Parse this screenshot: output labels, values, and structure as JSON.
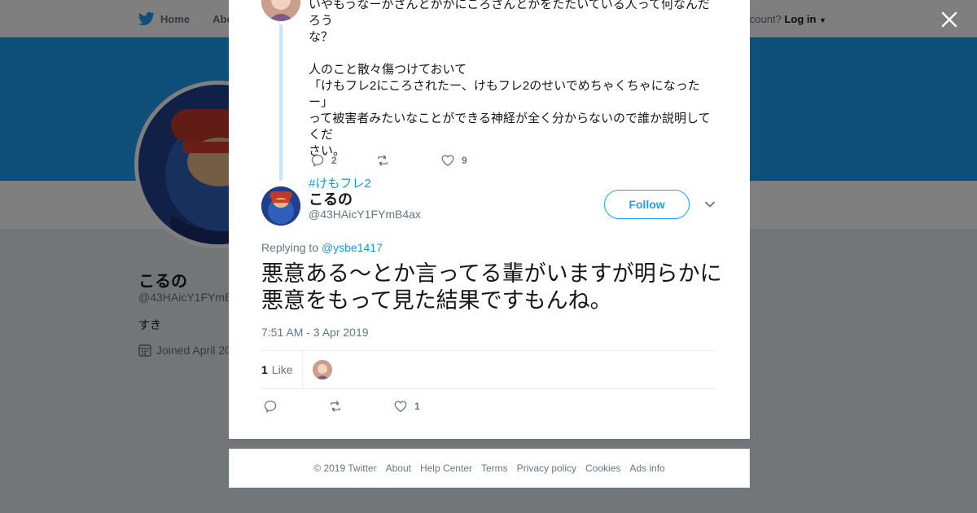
{
  "background": {
    "nav": {
      "home": "Home",
      "about": "Abo"
    },
    "login": {
      "prompt": "ccount?",
      "link": "Log in"
    },
    "profile": {
      "name": "こるの",
      "handle": "@43HAicY1FYmB",
      "bio": "すき",
      "joined": "Joined April 20"
    },
    "colors": {
      "banner": "#1da1f2"
    }
  },
  "previous_tweet": {
    "lines": [
      "いやもうなーがさんとかかにころさんとかをたたいている人って何なんだろう",
      "な？",
      "",
      "人のこと散々傷つけておいて",
      "「けもフレ2にころされたー、けもフレ2のせいでめちゃくちゃになったー」",
      "って被害者みたいなことができる神経が全く分からないので誰か説明してくだ",
      "さい。",
      ""
    ],
    "hashtag": "#けもフレ2",
    "reply_count": "2",
    "retweet_count": "",
    "like_count": "9"
  },
  "tweet": {
    "name": "こるの",
    "handle": "@43HAicY1FYmB4ax",
    "follow_label": "Follow",
    "replying_prefix": "Replying to",
    "replying_to": "@ysbe1417",
    "text": "悪意ある～とか言ってる輩がいますが明らかに悪意をもって見た結果ですもんね。",
    "timestamp": "7:51 AM - 3 Apr 2019",
    "likes_number": "1",
    "likes_label": "Like",
    "reply_count": "",
    "retweet_count": "",
    "like_count": "1"
  },
  "footer": {
    "links": [
      "© 2019 Twitter",
      "About",
      "Help Center",
      "Terms",
      "Privacy policy",
      "Cookies",
      "Ads info"
    ]
  }
}
